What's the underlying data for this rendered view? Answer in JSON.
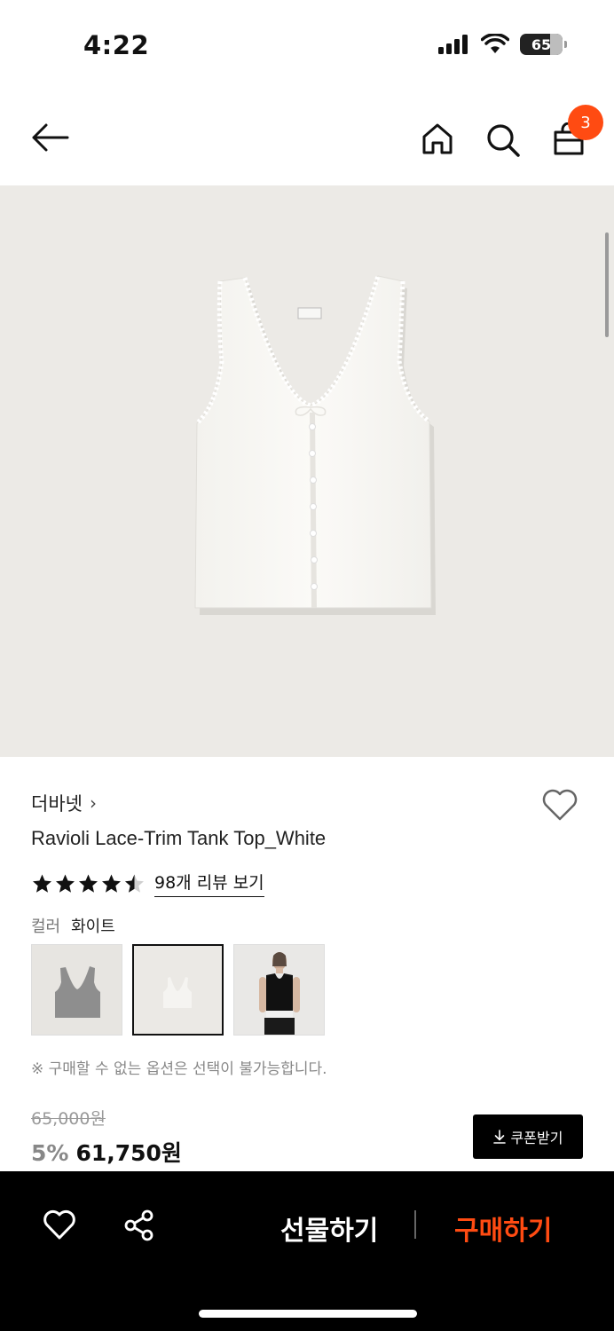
{
  "status_bar": {
    "time": "4:22",
    "battery": "65"
  },
  "header": {
    "cart_count": "3"
  },
  "product": {
    "brand": "더바넷",
    "brand_chevron": "›",
    "title": "Ravioli Lace-Trim Tank Top_White",
    "rating": 4.5,
    "review_link": "98개 리뷰 보기",
    "color_label": "컬러",
    "color_value": "화이트",
    "notice": "※ 구매할 수 없는 옵션은 선택이 불가능합니다.",
    "original_price": "65,000원",
    "discount": "5%",
    "sale_price": "61,750원",
    "coupon_label": "쿠폰받기"
  },
  "bottom_bar": {
    "gift_label": "선물하기",
    "buy_label": "구매하기"
  },
  "colors": {
    "accent": "#ff4b12",
    "bar": "#000000",
    "image_bg": "#eceae6"
  }
}
